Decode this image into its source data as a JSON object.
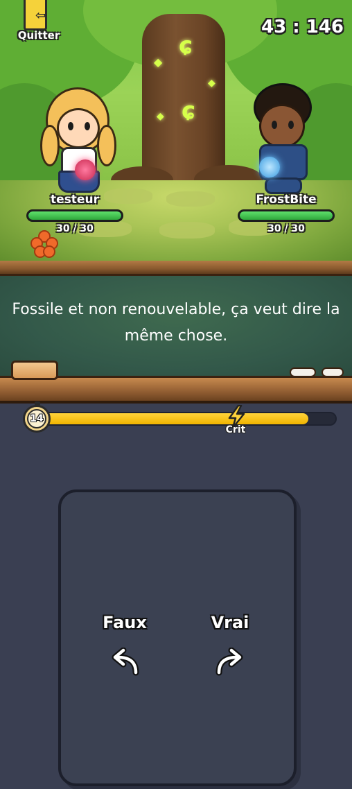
{
  "header": {
    "quit_label": "Quitter",
    "score": "43 : 146"
  },
  "players": {
    "left": {
      "name": "testeur",
      "hp_text": "30 / 30",
      "hp_fraction": 1.0
    },
    "right": {
      "name": "FrostBite",
      "hp_text": "30 / 30",
      "hp_fraction": 1.0
    }
  },
  "question": {
    "text": "Fossile et non renouvelable, ça veut dire la même chose."
  },
  "timer": {
    "seconds": "14",
    "fill_fraction": 0.91,
    "crit_label": "Crit"
  },
  "answers": {
    "left_label": "Faux",
    "right_label": "Vrai"
  },
  "colors": {
    "hp_green": "#2fa83c",
    "timer_yellow": "#f0b400",
    "board_green": "#33594a",
    "card_bg": "#3b4152"
  },
  "icons": {
    "quit": "exit-door-icon",
    "timer": "stopwatch-icon",
    "crit": "lightning-icon",
    "left_arrow": "undo-arrow-icon",
    "right_arrow": "redo-arrow-icon"
  }
}
